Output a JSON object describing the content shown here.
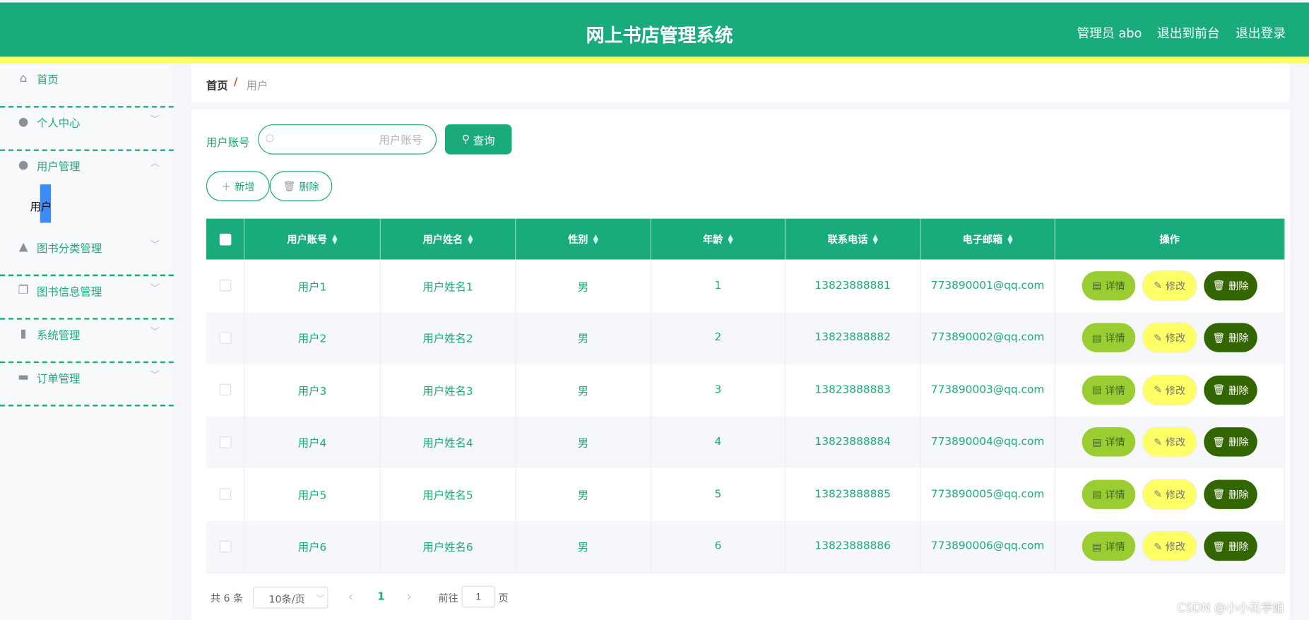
{
  "header": {
    "title": "网上书店管理系统",
    "links": [
      "管理员 abo",
      "退出到前台",
      "退出登录"
    ]
  },
  "colors": {
    "primary": "#1aab7c",
    "accent_bar": "#fefe62",
    "submenu_highlight": "#3b8cf5",
    "detail_btn": "#9acd32",
    "edit_btn": "#ffff66",
    "delete_btn": "#336600"
  },
  "sidebar": {
    "items": [
      {
        "label": "首页",
        "icon": "home-icon",
        "glyph": "⌂",
        "chevron": ""
      },
      {
        "label": "个人中心",
        "icon": "user-icon",
        "glyph": "●",
        "chevron": "﹀"
      },
      {
        "label": "用户管理",
        "icon": "bulb-icon",
        "glyph": "●",
        "chevron": "︿"
      },
      {
        "label": "图书分类管理",
        "icon": "stamp-icon",
        "glyph": "▲",
        "chevron": "﹀"
      },
      {
        "label": "图书信息管理",
        "icon": "copy-icon",
        "glyph": "❐",
        "chevron": "﹀"
      },
      {
        "label": "系统管理",
        "icon": "bar-chart-icon",
        "glyph": "▮",
        "chevron": "﹀"
      },
      {
        "label": "订单管理",
        "icon": "briefcase-icon",
        "glyph": "▬",
        "chevron": "﹀"
      }
    ],
    "subitem": "用户"
  },
  "breadcrumb": {
    "home": "首页",
    "sep": "/",
    "current": "用户"
  },
  "search": {
    "label": "用户账号",
    "placeholder": "用户账号",
    "value": "",
    "button": "查询"
  },
  "actions": {
    "add": "新增",
    "delete": "删除"
  },
  "table": {
    "columns": [
      "用户账号",
      "用户姓名",
      "性别",
      "年龄",
      "联系电话",
      "电子邮箱",
      "操作"
    ],
    "rows": [
      [
        "用户1",
        "用户姓名1",
        "男",
        "1",
        "13823888881",
        "773890001@qq.com"
      ],
      [
        "用户2",
        "用户姓名2",
        "男",
        "2",
        "13823888882",
        "773890002@qq.com"
      ],
      [
        "用户3",
        "用户姓名3",
        "男",
        "3",
        "13823888883",
        "773890003@qq.com"
      ],
      [
        "用户4",
        "用户姓名4",
        "男",
        "4",
        "13823888884",
        "773890004@qq.com"
      ],
      [
        "用户5",
        "用户姓名5",
        "男",
        "5",
        "13823888885",
        "773890005@qq.com"
      ],
      [
        "用户6",
        "用户姓名6",
        "男",
        "6",
        "13823888886",
        "773890006@qq.com"
      ]
    ],
    "row_actions": {
      "detail": "详情",
      "edit": "修改",
      "delete": "删除"
    }
  },
  "pagination": {
    "total": "共 6 条",
    "page_size": "10条/页",
    "prev": "‹",
    "current": "1",
    "next": "›",
    "goto": "前往",
    "goto_value": "1",
    "page_unit": "页"
  },
  "watermark": "CSDN @小小花学姐"
}
